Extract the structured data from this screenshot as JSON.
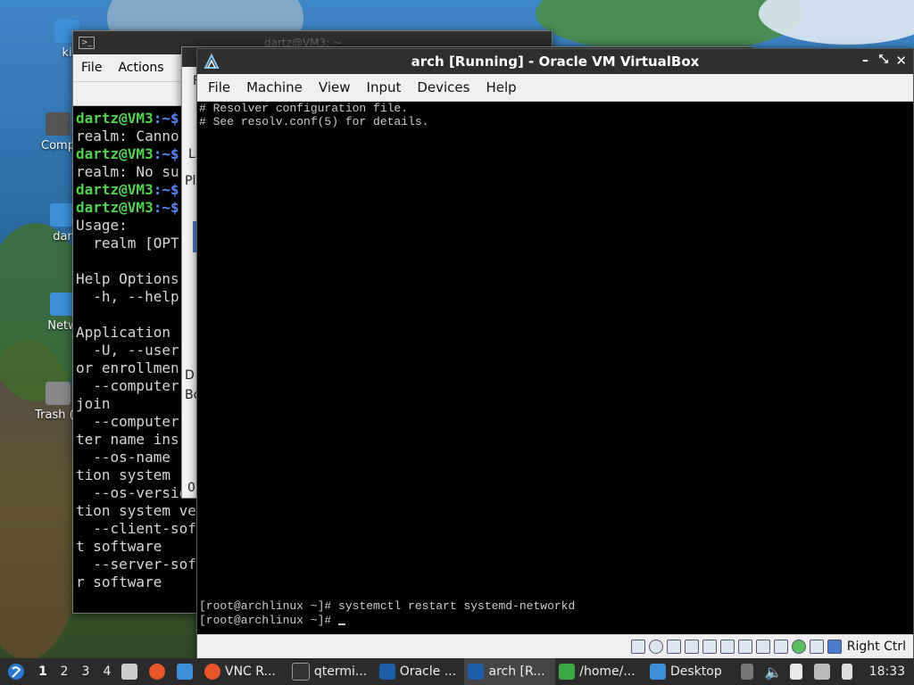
{
  "desktop": {
    "icons": [
      {
        "label": "ki"
      },
      {
        "label": "Comp"
      },
      {
        "label": "dar"
      },
      {
        "label": "Netw"
      },
      {
        "label": "Trash (E"
      }
    ]
  },
  "term1": {
    "title": "dartz@VM3: ~",
    "menu": [
      "File",
      "Actions"
    ],
    "lines": [
      {
        "user": "dartz@VM3",
        "path": ":~$",
        "text": ""
      },
      {
        "text": "realm: Canno"
      },
      {
        "user": "dartz@VM3",
        "path": ":~$",
        "text": ""
      },
      {
        "text": "realm: No su"
      },
      {
        "user": "dartz@VM3",
        "path": ":~$",
        "text": ""
      },
      {
        "user": "dartz@VM3",
        "path": ":~$",
        "text": ""
      },
      {
        "text": "Usage:"
      },
      {
        "text": "  realm [OPT"
      },
      {
        "text": ""
      },
      {
        "text": "Help Options"
      },
      {
        "text": "  -h, --help"
      },
      {
        "text": ""
      },
      {
        "text": "Application"
      },
      {
        "text": "  -U, --user"
      },
      {
        "text": "or enrollmen"
      },
      {
        "text": "  --computer"
      },
      {
        "text": "join"
      },
      {
        "text": "  --computer"
      },
      {
        "text": "ter name ins"
      },
      {
        "text": "  --os-name"
      },
      {
        "text": "tion system"
      },
      {
        "text": "  --os-versio"
      },
      {
        "text": "tion system ve"
      },
      {
        "text": "  --client-sof"
      },
      {
        "text": "t software"
      },
      {
        "text": "  --server-sof"
      },
      {
        "text": "r software"
      }
    ]
  },
  "fm": {
    "letters": [
      "F",
      "L",
      "Pl",
      "D",
      "Bo",
      "0"
    ]
  },
  "vbox": {
    "title": "arch [Running] - Oracle VM VirtualBox",
    "menu": [
      "File",
      "Machine",
      "View",
      "Input",
      "Devices",
      "Help"
    ],
    "screen_lines": [
      "# Resolver configuration file.",
      "# See resolv.conf(5) for details."
    ],
    "bottom_lines": [
      "[root@archlinux ~]# systemctl restart systemd-networkd",
      "[root@archlinux ~]# "
    ],
    "host_key": "Right Ctrl"
  },
  "taskbar": {
    "workspaces": [
      "1",
      "2",
      "3",
      "4"
    ],
    "active_workspace": "1",
    "tasks": [
      {
        "label": "VNC R...",
        "icon": "firefox-icon",
        "color": "#e8552b"
      },
      {
        "label": "qtermi...",
        "icon": "terminal-icon",
        "color": "#333333"
      },
      {
        "label": "Oracle ...",
        "icon": "virtualbox-icon",
        "color": "#1d5ea8"
      },
      {
        "label": "arch [R...",
        "icon": "virtualbox-icon",
        "color": "#1d5ea8"
      },
      {
        "label": "/home/...",
        "icon": "file-manager-icon",
        "color": "#3aa845"
      },
      {
        "label": "Desktop",
        "icon": "folder-icon",
        "color": "#3d8fd6"
      }
    ],
    "clock": "18:33"
  },
  "colors": {
    "prompt_user": "#4fd34f",
    "prompt_path": "#5b8bff",
    "taskbar_bg": "#2b2b2b"
  }
}
